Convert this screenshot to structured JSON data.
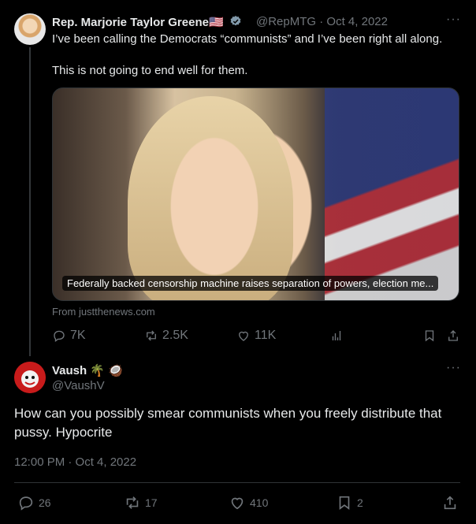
{
  "tweet": {
    "author_name": "Rep. Marjorie Taylor Greene",
    "flag_emoji": "🇺🇸",
    "handle": "@RepMTG",
    "date": "Oct 4, 2022",
    "text_line1": "I’ve been calling the Democrats “communists” and I’ve been right all along.",
    "text_line2": "This is not going to end well for them.",
    "card_caption": "Federally backed censorship machine raises separation of powers, election me...",
    "card_source": "From justthenews.com",
    "replies": "7K",
    "retweets": "2.5K",
    "likes": "11K",
    "menu": "···"
  },
  "reply": {
    "author_name": "Vaush",
    "emojis": "🌴 🥥",
    "handle": "@VaushV",
    "text": "How can you possibly smear communists when you freely distribute that pussy. Hypocrite",
    "timestamp": "12:00 PM · Oct 4, 2022",
    "replies": "26",
    "retweets": "17",
    "likes": "410",
    "bookmarks": "2",
    "menu": "···"
  },
  "colors": {
    "background": "#000000",
    "text": "#e7e9ea",
    "muted": "#71767b",
    "verified_badge": "#829aab",
    "divider": "#2f3336"
  },
  "icons": [
    "reply-icon",
    "retweet-icon",
    "like-icon",
    "views-icon",
    "bookmark-icon",
    "share-icon",
    "verified-badge-icon",
    "more-icon"
  ]
}
